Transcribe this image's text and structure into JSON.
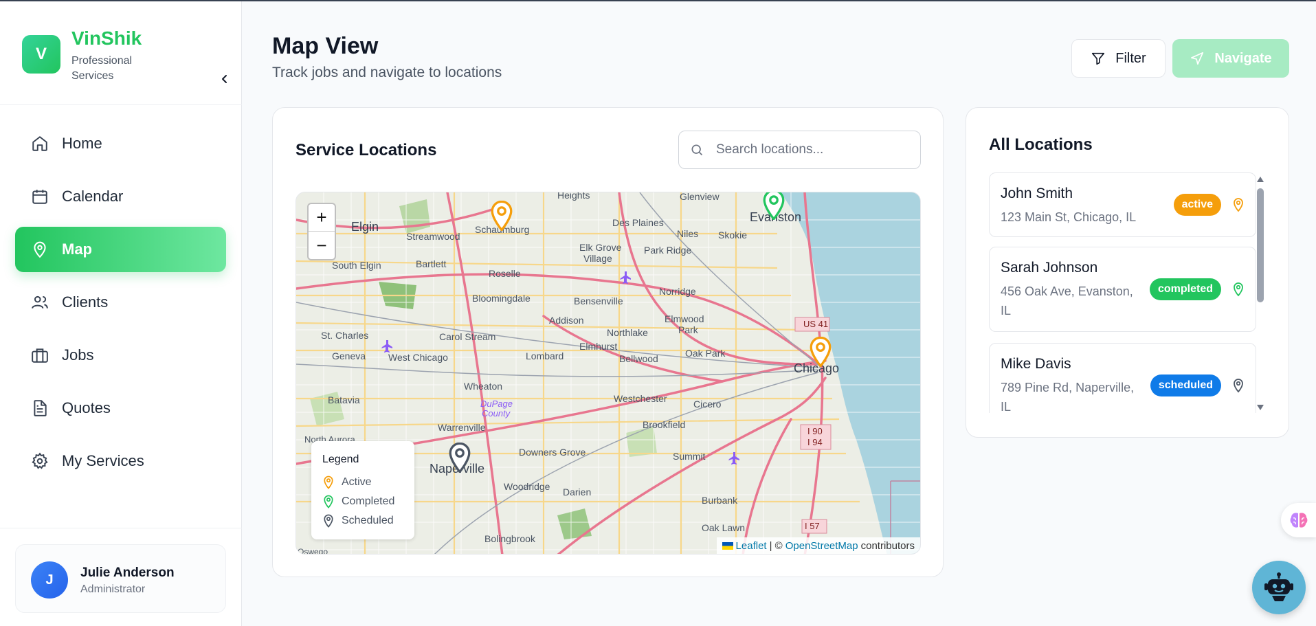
{
  "brand": {
    "logo_letter": "V",
    "name": "VinShik",
    "subtitle": "Professional Services"
  },
  "sidebar": {
    "items": [
      {
        "label": "Home",
        "icon": "home-icon"
      },
      {
        "label": "Calendar",
        "icon": "calendar-icon"
      },
      {
        "label": "Map",
        "icon": "map-pin-icon",
        "active": true
      },
      {
        "label": "Clients",
        "icon": "users-icon"
      },
      {
        "label": "Jobs",
        "icon": "briefcase-icon"
      },
      {
        "label": "Quotes",
        "icon": "document-icon"
      },
      {
        "label": "My Services",
        "icon": "gear-icon"
      }
    ]
  },
  "user": {
    "initial": "J",
    "name": "Julie Anderson",
    "role": "Administrator"
  },
  "header": {
    "title": "Map View",
    "subtitle": "Track jobs and navigate to locations",
    "filter_label": "Filter",
    "navigate_label": "Navigate"
  },
  "map_card": {
    "title": "Service Locations",
    "search_placeholder": "Search locations...",
    "zoom_in": "+",
    "zoom_out": "−",
    "legend": {
      "title": "Legend",
      "active": "Active",
      "completed": "Completed",
      "scheduled": "Scheduled"
    },
    "attribution": {
      "leaflet": "Leaflet",
      "separator": "| ©",
      "osm": "OpenStreetMap",
      "contributors": "contributors"
    },
    "labels": {
      "elgin": "Elgin",
      "schaumburg": "Schaumburg",
      "streamwood": "Streamwood",
      "south_elgin": "South Elgin",
      "bartlett": "Bartlett",
      "roselle": "Roselle",
      "des_plaines": "Des Plaines",
      "glenview": "Glenview",
      "evanston": "Evanston",
      "niles": "Niles",
      "skokie": "Skokie",
      "elk_grove": "Elk Grove",
      "village": "Village",
      "park_ridge": "Park Ridge",
      "bloomingdale": "Bloomingdale",
      "bensenville": "Bensenville",
      "norridge": "Norridge",
      "addison": "Addison",
      "elmwood": "Elmwood",
      "park": "Park",
      "st_charles": "St. Charles",
      "carol_stream": "Carol Stream",
      "northlake": "Northlake",
      "geneva": "Geneva",
      "west_chicago": "West Chicago",
      "lombard": "Lombard",
      "elmhurst": "Elmhurst",
      "bellwood": "Bellwood",
      "oak_park": "Oak Park",
      "chicago": "Chicago",
      "wheaton": "Wheaton",
      "dupage": "DuPage",
      "county": "County",
      "westchester": "Westchester",
      "cicero": "Cicero",
      "batavia": "Batavia",
      "warrenville": "Warrenville",
      "brookfield": "Brookfield",
      "north_aurora": "North Aurora",
      "naperville": "Naperville",
      "downers_grove": "Downers Grove",
      "summit": "Summit",
      "woodridge": "Woodridge",
      "darien": "Darien",
      "burbank": "Burbank",
      "oak_lawn": "Oak Lawn",
      "bolingbrook": "Bolingbrook",
      "oswego": "Oswego",
      "heights": "Heights",
      "us41": "US 41",
      "i90": "I 90",
      "i94": "I 94",
      "i57": "I 57"
    }
  },
  "locations_card": {
    "title": "All Locations",
    "items": [
      {
        "name": "John Smith",
        "address": "123 Main St, Chicago, IL",
        "status": "active"
      },
      {
        "name": "Sarah Johnson",
        "address": "456 Oak Ave, Evanston, IL",
        "status": "completed"
      },
      {
        "name": "Mike Davis",
        "address": "789 Pine Rd, Naperville, IL",
        "status": "scheduled"
      }
    ]
  },
  "colors": {
    "accent": "#22c55e",
    "active": "#f59e0b",
    "completed": "#22c55e",
    "scheduled": "#4b5563",
    "scheduled_badge": "#0f7be8"
  }
}
